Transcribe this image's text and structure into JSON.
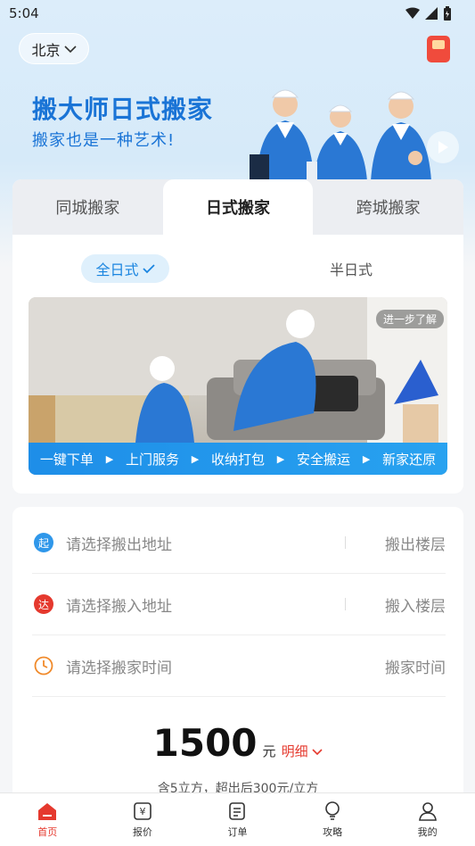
{
  "status_bar": {
    "time": "5:04"
  },
  "header": {
    "city": "北京",
    "banner_title": "搬大师日式搬家",
    "banner_subtitle": "搬家也是一种艺术!"
  },
  "tabs": [
    {
      "label": "同城搬家",
      "active": false
    },
    {
      "label": "日式搬家",
      "active": true
    },
    {
      "label": "跨城搬家",
      "active": false
    }
  ],
  "subtabs": {
    "active_label": "全日式",
    "other_label": "半日式"
  },
  "promo": {
    "learn_more": "进一步了解",
    "steps": [
      "一键下单",
      "上门服务",
      "收纳打包",
      "安全搬运",
      "新家还原"
    ]
  },
  "form": {
    "from": {
      "icon_text": "起",
      "placeholder": "请选择搬出地址",
      "floor_label": "搬出楼层"
    },
    "to": {
      "icon_text": "达",
      "placeholder": "请选择搬入地址",
      "floor_label": "搬入楼层"
    },
    "time": {
      "placeholder": "请选择搬家时间",
      "right_label": "搬家时间"
    },
    "price": "1500",
    "price_unit": "元",
    "detail_label": "明细",
    "price_note": "含5立方，超出后300元/立方"
  },
  "colors": {
    "accent_blue": "#1a85e0",
    "accent_red": "#e5392e"
  },
  "bottom_nav": [
    {
      "label": "首页",
      "icon": "home-icon",
      "active": true
    },
    {
      "label": "报价",
      "icon": "price-icon",
      "active": false
    },
    {
      "label": "订单",
      "icon": "order-icon",
      "active": false
    },
    {
      "label": "攻略",
      "icon": "bulb-icon",
      "active": false
    },
    {
      "label": "我的",
      "icon": "user-icon",
      "active": false
    }
  ]
}
